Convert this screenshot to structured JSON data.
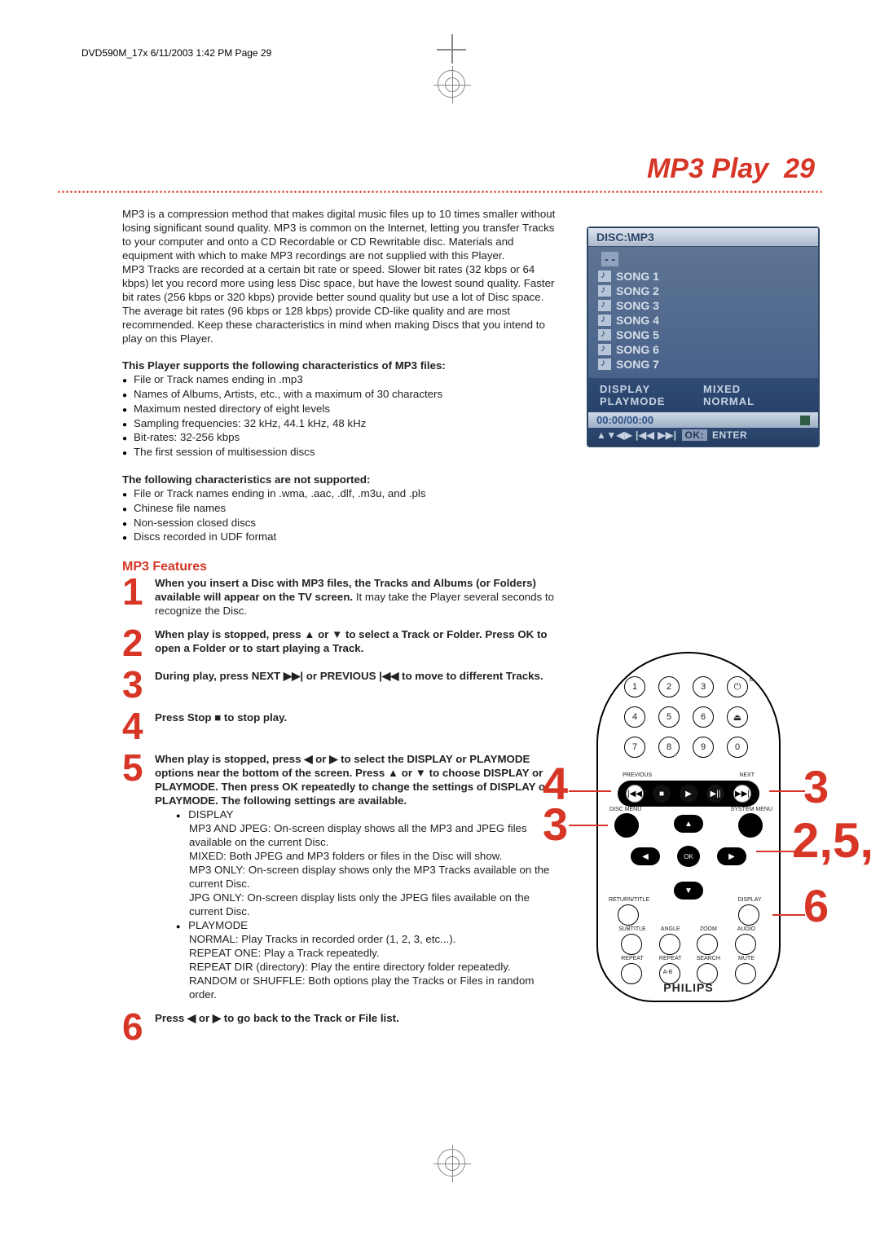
{
  "header_meta": "DVD590M_17x  6/11/2003  1:42 PM  Page 29",
  "page_title": "MP3 Play",
  "page_number": "29",
  "para1": "MP3 is a compression method that makes digital music files up to 10 times smaller without losing significant sound quality. MP3 is common on the Internet, letting you transfer Tracks to your computer and onto a CD Recordable or CD Rewritable disc. Materials and equipment with which to make MP3 recordings are not supplied with this Player.",
  "para2": "MP3 Tracks are recorded at a certain bit rate or speed. Slower bit rates (32 kbps or 64 kbps) let you record more using less Disc space, but have the lowest sound quality. Faster bit rates (256 kbps or 320 kbps) provide better sound quality but use a lot of Disc space. The average bit rates (96 kbps or 128 kbps) provide CD-like quality and are most recommended. Keep these characteristics in mind when making Discs that you intend to play on this Player.",
  "supports_heading": "This Player supports the following characteristics of MP3 files:",
  "supports": [
    "File or Track names ending in .mp3",
    "Names of Albums, Artists, etc., with a maximum of 30 characters",
    "Maximum nested directory of eight levels",
    "Sampling frequencies: 32 kHz, 44.1 kHz, 48 kHz",
    "Bit-rates: 32-256 kbps",
    "The first session of multisession discs"
  ],
  "notsup_heading": "The following characteristics are not supported:",
  "notsup": [
    "File or Track names ending in .wma, .aac, .dlf, .m3u, and .pls",
    "Chinese file names",
    "Non-session closed discs",
    "Discs recorded in UDF format"
  ],
  "features_heading": "MP3 Features",
  "steps": {
    "s1_b": "When you insert a Disc with MP3 files, the Tracks and Albums (or Folders) available will appear on the TV screen.",
    "s1_r": " It may take the Player several seconds to recognize the Disc.",
    "s2_b": "When play is stopped, press ▲ or ▼ to select a Track or Folder. Press OK to open a Folder or to start playing a Track.",
    "s3_b": "During play, press NEXT ▶▶| or PREVIOUS |◀◀ to move to different Tracks.",
    "s4_b": "Press Stop ■ to stop play.",
    "s5_b": "When play is stopped, press ◀ or ▶ to select the DISPLAY or PLAYMODE options near the bottom of the screen. Press ▲ or ▼ to choose DISPLAY or PLAYMODE. Then press OK repeatedly to change the settings of DISPLAY or PLAYMODE. The following settings are available.",
    "s5_display_h": "DISPLAY",
    "s5_display": [
      "MP3 AND JPEG: On-screen display shows all the MP3 and JPEG files available on the current Disc.",
      "MIXED: Both JPEG and MP3 folders or files in the Disc will show.",
      "MP3 ONLY: On-screen display shows only the MP3 Tracks available on the current Disc.",
      "JPG ONLY: On-screen display lists only the JPEG files available on the current Disc."
    ],
    "s5_playmode_h": "PLAYMODE",
    "s5_playmode": [
      "NORMAL: Play Tracks in recorded order (1, 2, 3, etc...).",
      "REPEAT ONE: Play a Track repeatedly.",
      "REPEAT DIR (directory): Play the entire directory folder repeatedly.",
      "RANDOM or SHUFFLE: Both options play the Tracks or Files in random order."
    ],
    "s6_b": "Press ◀ or ▶ to go back to the Track or File list."
  },
  "osd": {
    "title": "DISC:\\MP3",
    "folder": "- -",
    "songs": [
      "SONG 1",
      "SONG 2",
      "SONG 3",
      "SONG 4",
      "SONG 5",
      "SONG 6",
      "SONG 7"
    ],
    "opt_display": "DISPLAY",
    "opt_display_v": "MIXED",
    "opt_playmode": "PLAYMODE",
    "opt_playmode_v": "NORMAL",
    "time": "00:00/00:00",
    "hint_arrows": "▲▼◀▶ |◀◀  ▶▶|",
    "hint_ok": "OK:",
    "hint_enter": "ENTER"
  },
  "remote": {
    "logo": "PHILIPS",
    "eject_lbl": "EJECT",
    "eject_glyph": "⏏",
    "prev_lbl": "PREVIOUS",
    "next_lbl": "NEXT",
    "disc_lbl": "DISC MENU",
    "sys_lbl": "SYSTEM MENU",
    "ok": "OK",
    "return_lbl": "RETURN/TITLE",
    "display_lbl": "DISPLAY",
    "fn1": [
      "SUBTITLE",
      "ANGLE",
      "ZOOM",
      "AUDIO"
    ],
    "fn2": [
      "REPEAT",
      "REPEAT",
      "SEARCH",
      "MUTE"
    ],
    "ab": "A-B",
    "transport": {
      "prev": "|◀◀",
      "stop": "■",
      "play": "▶",
      "pause": "▶||",
      "next": "▶▶|"
    },
    "numbers": [
      "1",
      "2",
      "3",
      "",
      "4",
      "5",
      "6",
      "",
      "7",
      "8",
      "9",
      "0"
    ]
  },
  "callouts": {
    "c4": "4",
    "c3a": "3",
    "c3b": "3",
    "c25": "2,5,",
    "c6": "6"
  }
}
